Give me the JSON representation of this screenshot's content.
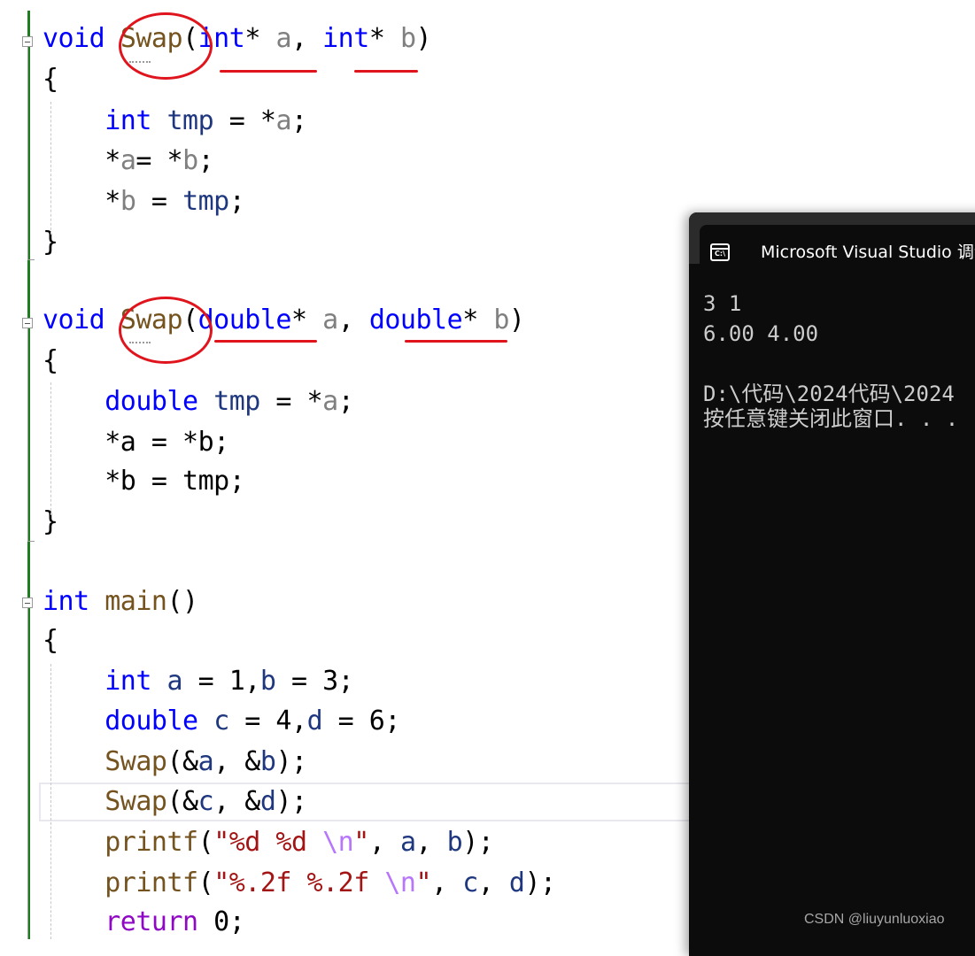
{
  "editor": {
    "lines": [
      [
        [
          "kw",
          "void"
        ],
        [
          "pl",
          " "
        ],
        [
          "fn",
          "Swap"
        ],
        [
          "pl",
          "("
        ],
        [
          "kw",
          "int"
        ],
        [
          "pl",
          "* "
        ],
        [
          "par",
          "a"
        ],
        [
          "pl",
          ", "
        ],
        [
          "kw",
          "int"
        ],
        [
          "pl",
          "* "
        ],
        [
          "par",
          "b"
        ],
        [
          "pl",
          ")"
        ]
      ],
      [
        [
          "pl",
          "{"
        ]
      ],
      [
        [
          "pl",
          "    "
        ],
        [
          "kw",
          "int"
        ],
        [
          "pl",
          " "
        ],
        [
          "loc",
          "tmp"
        ],
        [
          "pl",
          " = *"
        ],
        [
          "par",
          "a"
        ],
        [
          "pl",
          ";"
        ]
      ],
      [
        [
          "pl",
          "    *"
        ],
        [
          "par",
          "a"
        ],
        [
          "pl",
          "= *"
        ],
        [
          "par",
          "b"
        ],
        [
          "pl",
          ";"
        ]
      ],
      [
        [
          "pl",
          "    *"
        ],
        [
          "par",
          "b"
        ],
        [
          "pl",
          " = "
        ],
        [
          "loc",
          "tmp"
        ],
        [
          "pl",
          ";"
        ]
      ],
      [
        [
          "pl",
          "}"
        ]
      ],
      [],
      [
        [
          "kw",
          "void"
        ],
        [
          "pl",
          " "
        ],
        [
          "fn",
          "Swap"
        ],
        [
          "pl",
          "("
        ],
        [
          "kw",
          "double"
        ],
        [
          "pl",
          "* "
        ],
        [
          "par",
          "a"
        ],
        [
          "pl",
          ", "
        ],
        [
          "kw",
          "double"
        ],
        [
          "pl",
          "* "
        ],
        [
          "par",
          "b"
        ],
        [
          "pl",
          ")"
        ]
      ],
      [
        [
          "pl",
          "{"
        ]
      ],
      [
        [
          "pl",
          "    "
        ],
        [
          "kw",
          "double"
        ],
        [
          "pl",
          " "
        ],
        [
          "loc",
          "tmp"
        ],
        [
          "pl",
          " = *"
        ],
        [
          "par",
          "a"
        ],
        [
          "pl",
          ";"
        ]
      ],
      [
        [
          "pl",
          "    *a = *b;"
        ]
      ],
      [
        [
          "pl",
          "    *b = tmp;"
        ]
      ],
      [
        [
          "pl",
          "}"
        ]
      ],
      [],
      [
        [
          "kw",
          "int"
        ],
        [
          "pl",
          " "
        ],
        [
          "fn",
          "main"
        ],
        [
          "pl",
          "()"
        ]
      ],
      [
        [
          "pl",
          "{"
        ]
      ],
      [
        [
          "pl",
          "    "
        ],
        [
          "kw",
          "int"
        ],
        [
          "pl",
          " "
        ],
        [
          "loc",
          "a"
        ],
        [
          "pl",
          " = 1,"
        ],
        [
          "loc",
          "b"
        ],
        [
          "pl",
          " = 3;"
        ]
      ],
      [
        [
          "pl",
          "    "
        ],
        [
          "kw",
          "double"
        ],
        [
          "pl",
          " "
        ],
        [
          "loc",
          "c"
        ],
        [
          "pl",
          " = 4,"
        ],
        [
          "loc",
          "d"
        ],
        [
          "pl",
          " = 6;"
        ]
      ],
      [
        [
          "pl",
          "    "
        ],
        [
          "fn",
          "Swap"
        ],
        [
          "pl",
          "(&"
        ],
        [
          "loc",
          "a"
        ],
        [
          "pl",
          ", &"
        ],
        [
          "loc",
          "b"
        ],
        [
          "pl",
          ");"
        ]
      ],
      [
        [
          "pl",
          "    "
        ],
        [
          "fn",
          "Swap"
        ],
        [
          "pl",
          "(&"
        ],
        [
          "loc",
          "c"
        ],
        [
          "pl",
          ", &"
        ],
        [
          "loc",
          "d"
        ],
        [
          "pl",
          ");"
        ]
      ],
      [
        [
          "pl",
          "    "
        ],
        [
          "fn",
          "printf"
        ],
        [
          "pl",
          "("
        ],
        [
          "str",
          "\"%d %d "
        ],
        [
          "esc",
          "\\n"
        ],
        [
          "str",
          "\""
        ],
        [
          "pl",
          ", "
        ],
        [
          "loc",
          "a"
        ],
        [
          "pl",
          ", "
        ],
        [
          "loc",
          "b"
        ],
        [
          "pl",
          ");"
        ]
      ],
      [
        [
          "pl",
          "    "
        ],
        [
          "fn",
          "printf"
        ],
        [
          "pl",
          "("
        ],
        [
          "str",
          "\"%.2f %.2f "
        ],
        [
          "esc",
          "\\n"
        ],
        [
          "str",
          "\""
        ],
        [
          "pl",
          ", "
        ],
        [
          "loc",
          "c"
        ],
        [
          "pl",
          ", "
        ],
        [
          "loc",
          "d"
        ],
        [
          "pl",
          ");"
        ]
      ],
      [
        [
          "pl",
          "    "
        ],
        [
          "ret",
          "return"
        ],
        [
          "pl",
          " 0;"
        ]
      ]
    ],
    "current_line": 20
  },
  "console": {
    "title": "Microsoft Visual Studio 调试控制台",
    "icon": "console-icon",
    "icon_text": "C:\\",
    "output": [
      "3 1",
      "6.00 4.00",
      "",
      "D:\\代码\\2024代码\\2024",
      "按任意键关闭此窗口. . ."
    ]
  },
  "watermark": "CSDN @liuyunluoxiao",
  "annotation_color": "#e0141c"
}
